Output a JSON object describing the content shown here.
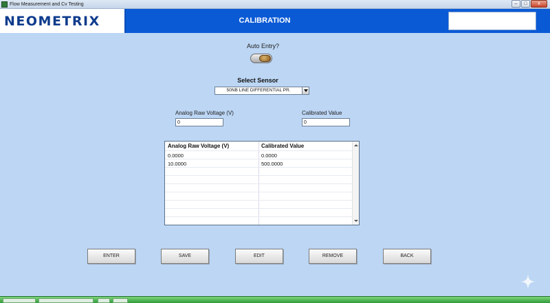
{
  "window": {
    "title": "Flow Measurement and Cv Testing",
    "min": "–",
    "max": "□",
    "close": "x"
  },
  "header": {
    "logo": "NEOMETRIX",
    "title": "CALIBRATION",
    "right_box_value": ""
  },
  "auto_entry": {
    "label": "Auto Entry?",
    "on": true
  },
  "sensor": {
    "label": "Select Sensor",
    "selected": "50NB LINE DIFFERENTIAL PR."
  },
  "inputs": {
    "raw_label": "Analog Raw Voltage (V)",
    "raw_value": "0",
    "cal_label": "Calibrated Value",
    "cal_value": "0"
  },
  "table": {
    "headers": [
      "Analog Raw Voltage (V)",
      "Calibrated Value"
    ],
    "rows": [
      [
        "0.0000",
        "0.0000"
      ],
      [
        "10.0000",
        "500.0000"
      ]
    ]
  },
  "buttons": {
    "enter": "ENTER",
    "save": "SAVE",
    "edit": "EDIT",
    "remove": "REMOVE",
    "back": "BACK"
  },
  "colors": {
    "background": "#bcd6f4",
    "header": "#0a5ad6",
    "logo": "#0d3b8c",
    "taskbar": "#2f9a3a"
  }
}
